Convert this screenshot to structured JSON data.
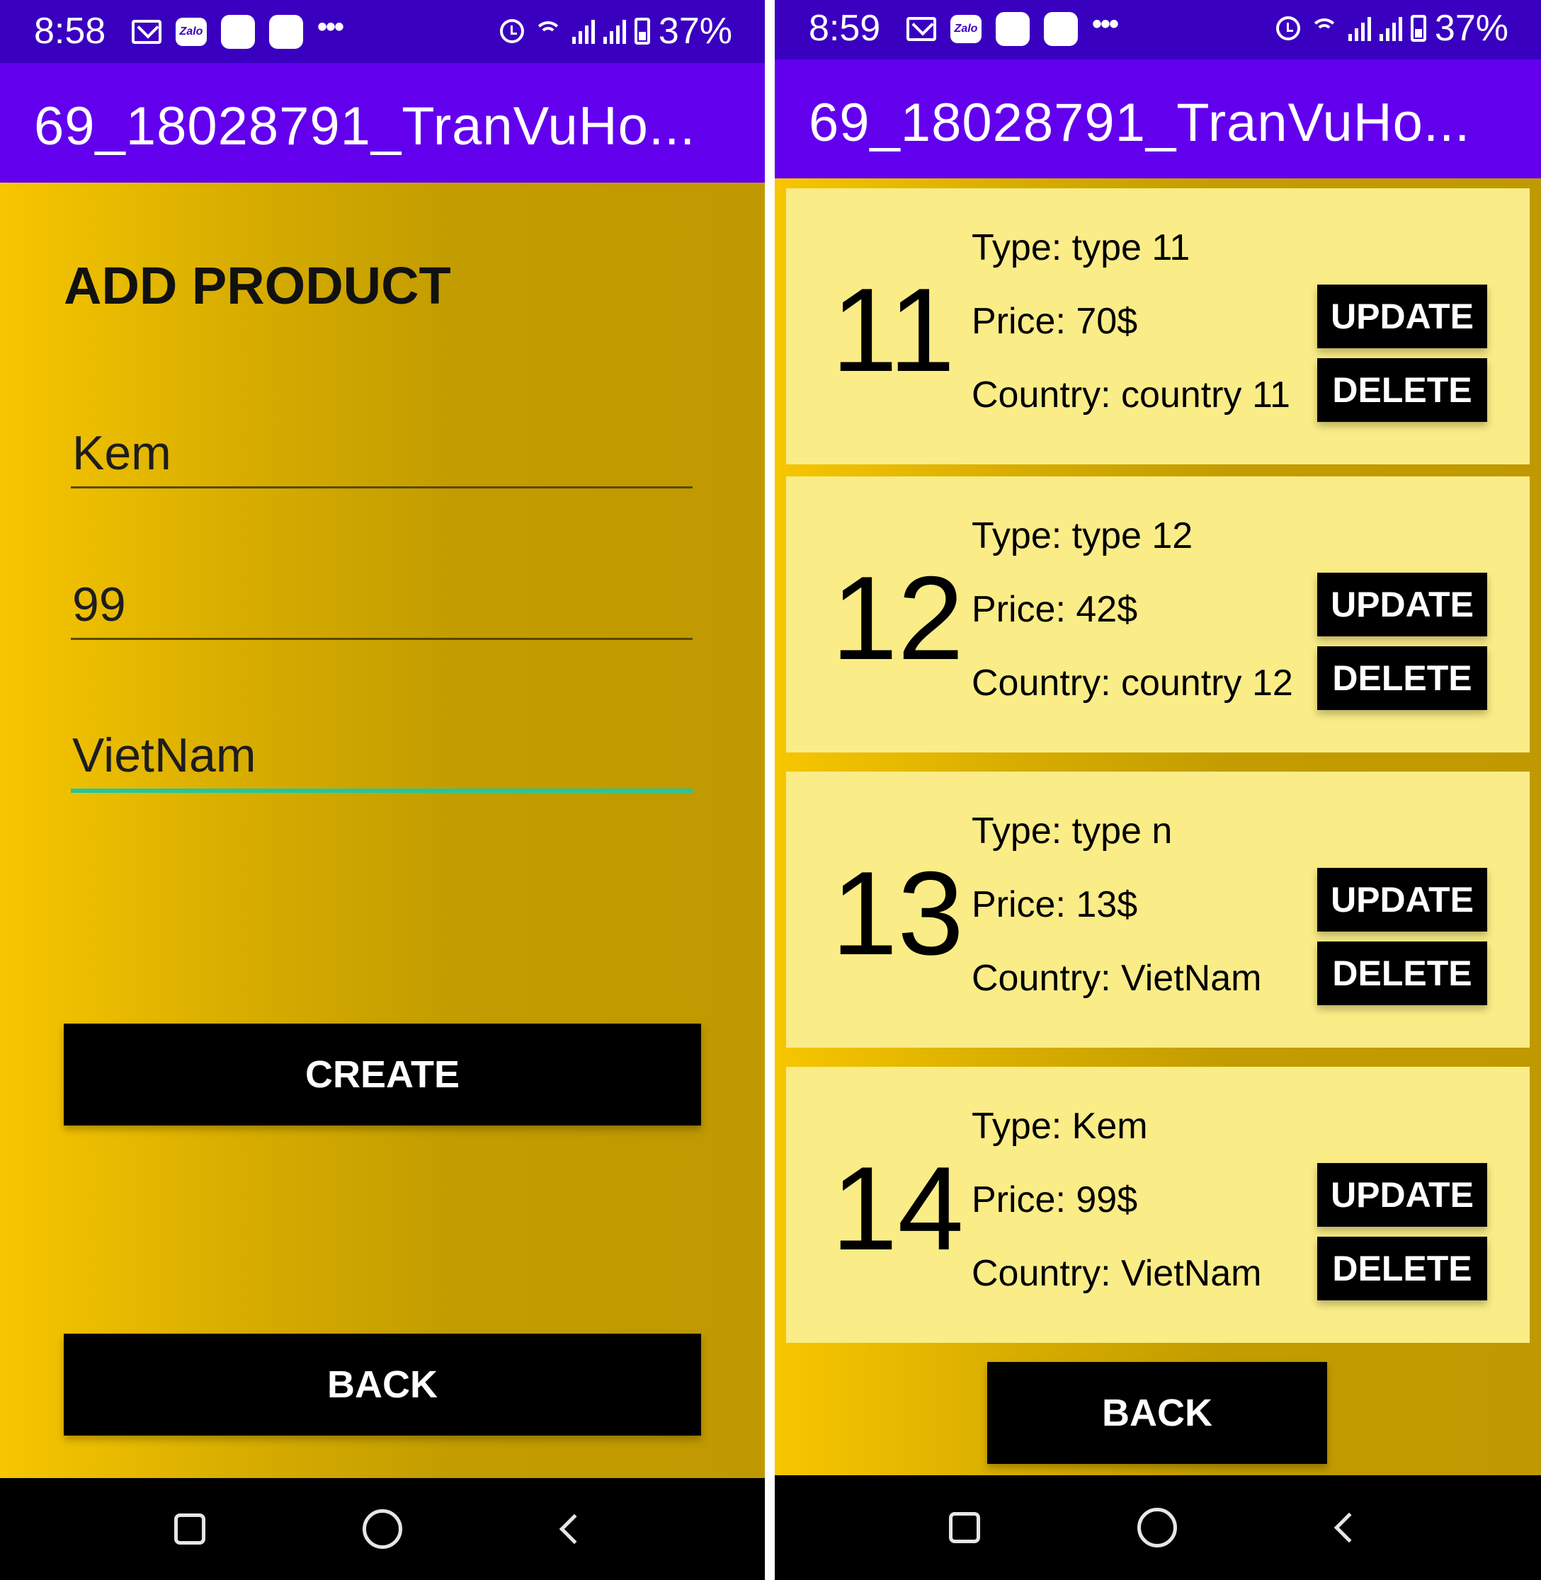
{
  "left_screen": {
    "status": {
      "time": "8:58",
      "battery": "37%",
      "zalo": "Zalo"
    },
    "app_title": "69_18028791_TranVuHo...",
    "heading": "ADD PRODUCT",
    "fields": {
      "name": "Kem",
      "price": "99",
      "country": "VietNam"
    },
    "create_label": "CREATE",
    "back_label": "BACK"
  },
  "right_screen": {
    "status": {
      "time": "8:59",
      "battery": "37%",
      "zalo": "Zalo"
    },
    "app_title": "69_18028791_TranVuHo...",
    "products": [
      {
        "id": "11",
        "type": "Type: type 11",
        "price": "Price: 70$",
        "country": "Country: country 11",
        "update": "UPDATE",
        "delete": "DELETE"
      },
      {
        "id": "12",
        "type": "Type: type 12",
        "price": "Price: 42$",
        "country": "Country: country 12",
        "update": "UPDATE",
        "delete": "DELETE"
      },
      {
        "id": "13",
        "type": "Type: type n",
        "price": "Price: 13$",
        "country": "Country: VietNam",
        "update": "UPDATE",
        "delete": "DELETE"
      },
      {
        "id": "14",
        "type": "Type: Kem",
        "price": "Price: 99$",
        "country": "Country: VietNam",
        "update": "UPDATE",
        "delete": "DELETE"
      }
    ],
    "back_label": "BACK"
  },
  "icons": {
    "status_left": [
      "gmail-icon",
      "zalo-icon",
      "app-icon",
      "app-icon",
      "more-icon"
    ],
    "status_right": [
      "alarm-icon",
      "wifi-icon",
      "signal-icon",
      "signal-icon",
      "battery-icon"
    ],
    "nav": [
      "recent-apps-icon",
      "home-icon",
      "back-icon"
    ]
  },
  "colors": {
    "status_bar": "#3a00c0",
    "app_bar": "#6200ee",
    "background_gradient": [
      "#f7c600",
      "#c09900"
    ],
    "card": "#faec86",
    "button": "#000000",
    "focus_underline": "#1fc8a0"
  }
}
